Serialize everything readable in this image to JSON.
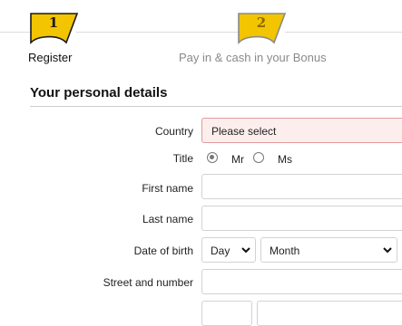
{
  "steps": [
    {
      "number": "1",
      "label": "Register",
      "active": true
    },
    {
      "number": "2",
      "label": "Pay in & cash in your Bonus",
      "active": false
    }
  ],
  "colors": {
    "badge_yellow": "#f3c400",
    "badge_border": "#1a1a1a",
    "badge_inactive_border": "#8a8a8a",
    "error_bg": "#fdeeee",
    "error_border": "#e39b9b"
  },
  "section": {
    "title": "Your personal details"
  },
  "form": {
    "country": {
      "label": "Country",
      "value": "Please select"
    },
    "title": {
      "label": "Title",
      "options": [
        "Mr",
        "Ms"
      ],
      "selected": "Mr"
    },
    "first_name": {
      "label": "First name",
      "value": ""
    },
    "last_name": {
      "label": "Last name",
      "value": ""
    },
    "dob": {
      "label": "Date of birth",
      "day": "Day",
      "month": "Month"
    },
    "street": {
      "label": "Street and number",
      "value": ""
    }
  }
}
